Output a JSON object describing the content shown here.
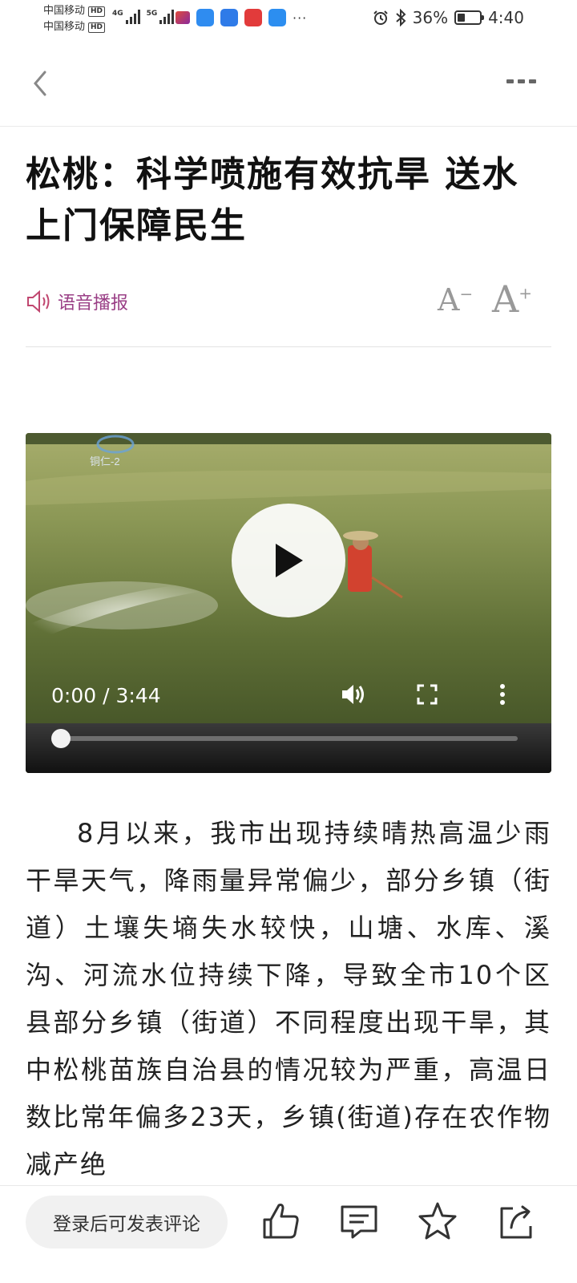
{
  "status_bar": {
    "carrier_1": "中国移动",
    "carrier_2": "中国移动",
    "hd_badge": "HD",
    "net_1": "4G",
    "net_2": "5G",
    "battery_percent": "36%",
    "battery_level": 0.36,
    "time": "4:40"
  },
  "article": {
    "title": "松桃：科学喷施有效抗旱 送水上门保障民生",
    "voice_label": "语音播报",
    "font_decrease": "A",
    "font_increase": "A",
    "body": "8月以来，我市出现持续晴热高温少雨干旱天气，降雨量异常偏少，部分乡镇（街道）土壤失墒失水较快，山塘、水库、溪沟、河流水位持续下降，导致全市10个区县部分乡镇（街道）不同程度出现干旱，其中松桃苗族自治县的情况较为严重，高温日数比常年偏多23天，乡镇(街道)存在农作物减产绝"
  },
  "video": {
    "watermark": "铜仁-2",
    "time_display": "0:00 / 3:44",
    "progress": 0
  },
  "bottom_bar": {
    "comment_placeholder": "登录后可发表评论"
  },
  "colors": {
    "accent": "#9a3f86",
    "title": "#111111",
    "body_text": "#222222"
  },
  "icons": [
    "back-icon",
    "more-icon",
    "speaker-icon",
    "play-icon",
    "volume-icon",
    "fullscreen-icon",
    "kebab-icon",
    "like-icon",
    "comment-icon",
    "star-icon",
    "share-icon"
  ]
}
